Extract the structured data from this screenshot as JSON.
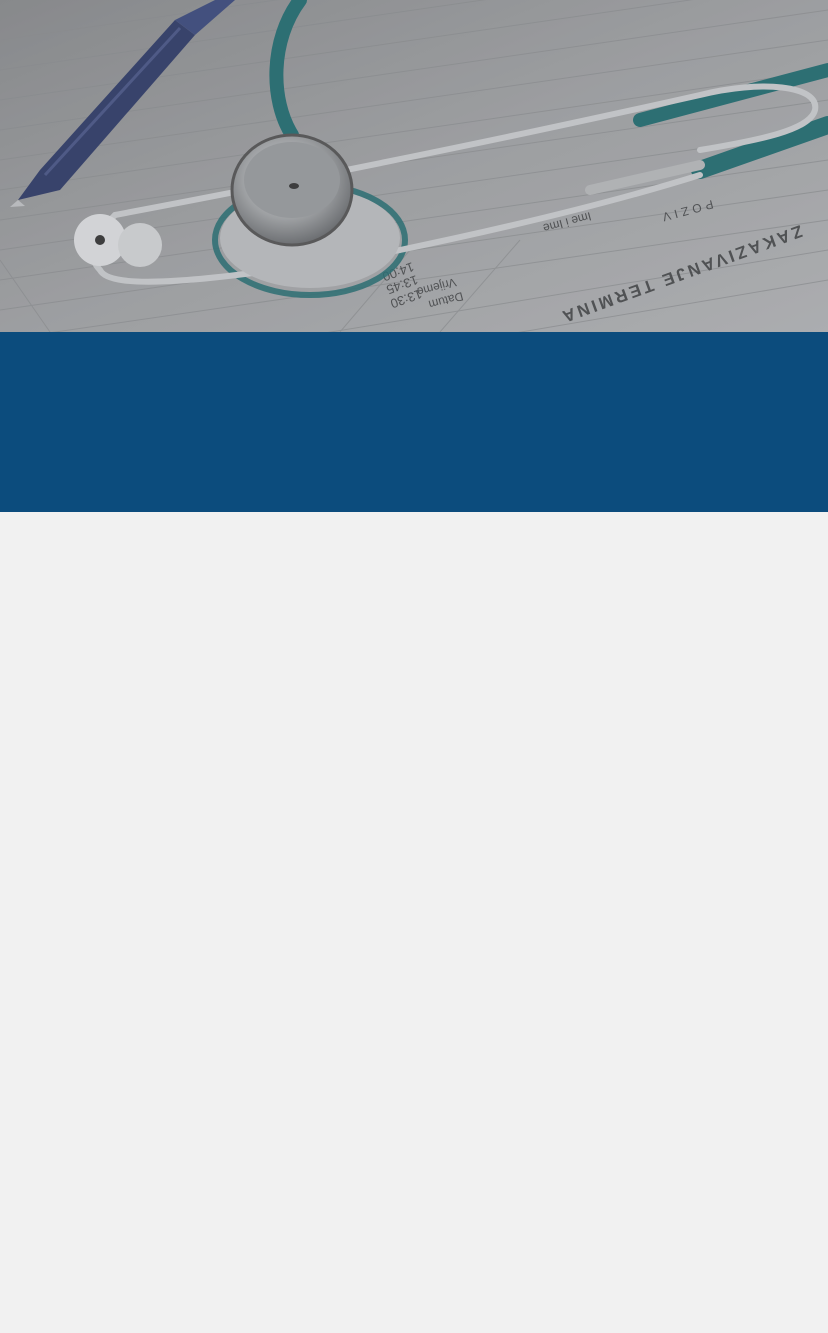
{
  "hero": {
    "image_kind": "stethoscope-on-appointment-ledger",
    "ledger_heading": "ZAKAZIVANJE TERMINA",
    "ledger_poziv": "POZIV",
    "ledger_col_name": "Ime i Ime",
    "ledger_col_date": "Datum",
    "ledger_col_time": "Vrijeme",
    "ledger_times": [
      "14:00",
      "13:45",
      "13:30"
    ]
  },
  "colors": {
    "banner": "#0c4c7d",
    "page_background": "#f1f1f1",
    "stethoscope_tubing": "#1f6f73",
    "pen": "#2d3a6a"
  }
}
